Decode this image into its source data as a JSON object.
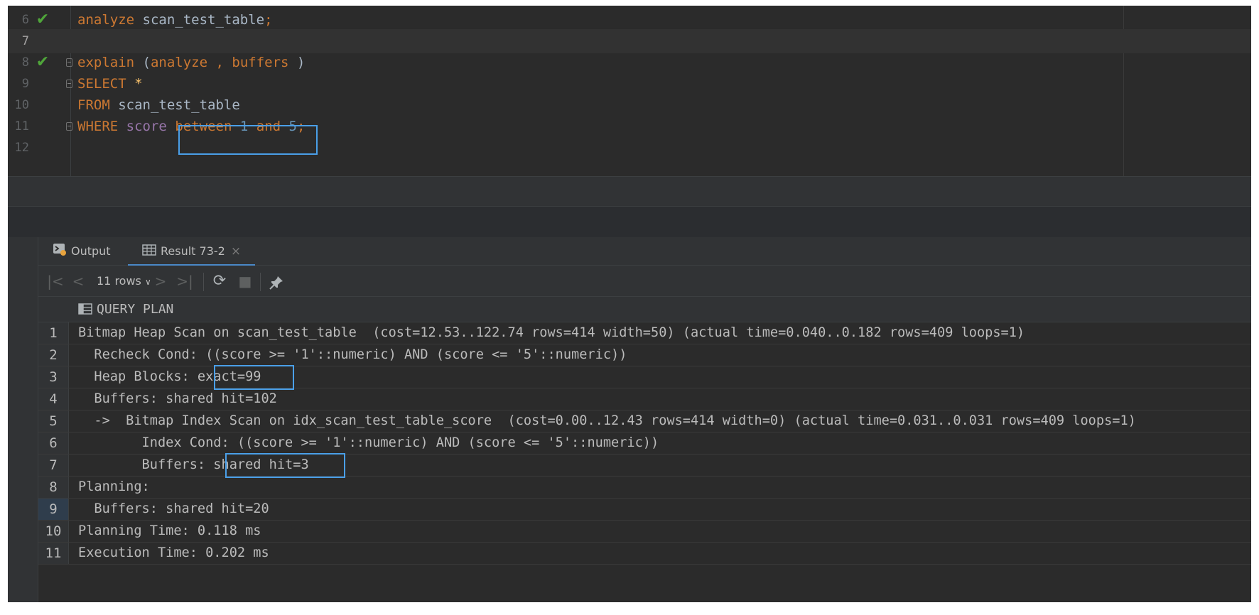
{
  "editor": {
    "lines": [
      {
        "num": "6",
        "check": true,
        "fold": false,
        "tokens": [
          {
            "t": "analyze",
            "c": "kw"
          },
          {
            "t": " scan_test_table",
            "c": "id"
          },
          {
            "t": ";",
            "c": "kw"
          }
        ]
      },
      {
        "num": "7",
        "check": false,
        "fold": false,
        "current": true,
        "tokens": []
      },
      {
        "num": "8",
        "check": true,
        "fold": true,
        "tokens": [
          {
            "t": "explain",
            "c": "kw"
          },
          {
            "t": " (",
            "c": "id"
          },
          {
            "t": "analyze",
            "c": "kw"
          },
          {
            "t": " , ",
            "c": "kw"
          },
          {
            "t": "buffers",
            "c": "kw"
          },
          {
            "t": " )",
            "c": "id"
          }
        ]
      },
      {
        "num": "9",
        "check": false,
        "fold": true,
        "tokens": [
          {
            "t": "SELECT",
            "c": "kw"
          },
          {
            "t": " ",
            "c": "id"
          },
          {
            "t": "*",
            "c": "star"
          }
        ]
      },
      {
        "num": "10",
        "check": false,
        "fold": false,
        "tokens": [
          {
            "t": "FROM",
            "c": "kw"
          },
          {
            "t": " scan_test_table",
            "c": "id"
          }
        ]
      },
      {
        "num": "11",
        "check": false,
        "fold": true,
        "tokens": [
          {
            "t": "WHERE",
            "c": "kw"
          },
          {
            "t": " ",
            "c": "id"
          },
          {
            "t": "score",
            "c": "col"
          },
          {
            "t": " ",
            "c": "id"
          },
          {
            "t": "between",
            "c": "kw"
          },
          {
            "t": " ",
            "c": "id"
          },
          {
            "t": "1",
            "c": "num"
          },
          {
            "t": " ",
            "c": "id"
          },
          {
            "t": "and",
            "c": "kw"
          },
          {
            "t": " ",
            "c": "id"
          },
          {
            "t": "5",
            "c": "num"
          },
          {
            "t": ";",
            "c": "kw"
          }
        ]
      },
      {
        "num": "12",
        "check": false,
        "fold": false,
        "tokens": []
      }
    ]
  },
  "tabs": [
    {
      "label": "Output",
      "icon": "console-icon",
      "active": false
    },
    {
      "label": "Result 73-2",
      "icon": "table-icon",
      "active": true,
      "closable": true
    }
  ],
  "toolbar": {
    "rows_label": "11 rows",
    "icons": [
      "first-page-icon",
      "prev-page-icon",
      "next-page-icon",
      "last-page-icon",
      "refresh-icon",
      "stop-icon",
      "pin-icon"
    ]
  },
  "grid": {
    "column_header": "QUERY PLAN",
    "rows": [
      {
        "n": "1",
        "text": "Bitmap Heap Scan on scan_test_table  (cost=12.53..122.74 rows=414 width=50) (actual time=0.040..0.182 rows=409 loops=1)"
      },
      {
        "n": "2",
        "text": "  Recheck Cond: ((score >= '1'::numeric) AND (score <= '5'::numeric))"
      },
      {
        "n": "3",
        "text": "  Heap Blocks: exact=99"
      },
      {
        "n": "4",
        "text": "  Buffers: shared hit=102"
      },
      {
        "n": "5",
        "text": "  ->  Bitmap Index Scan on idx_scan_test_table_score  (cost=0.00..12.43 rows=414 width=0) (actual time=0.031..0.031 rows=409 loops=1)"
      },
      {
        "n": "6",
        "text": "        Index Cond: ((score >= '1'::numeric) AND (score <= '5'::numeric))"
      },
      {
        "n": "7",
        "text": "        Buffers: shared hit=3"
      },
      {
        "n": "8",
        "text": "Planning:"
      },
      {
        "n": "9",
        "text": "  Buffers: shared hit=20",
        "selected": true
      },
      {
        "n": "10",
        "text": "Planning Time: 0.118 ms"
      },
      {
        "n": "11",
        "text": "Execution Time: 0.202 ms"
      }
    ]
  },
  "colors": {
    "editor_bg": "#2b2b2b",
    "keyword": "#cc7832",
    "number": "#6897bb",
    "column": "#9876aa",
    "highlight_box": "#4a9fe8",
    "check": "#4fa53a"
  }
}
